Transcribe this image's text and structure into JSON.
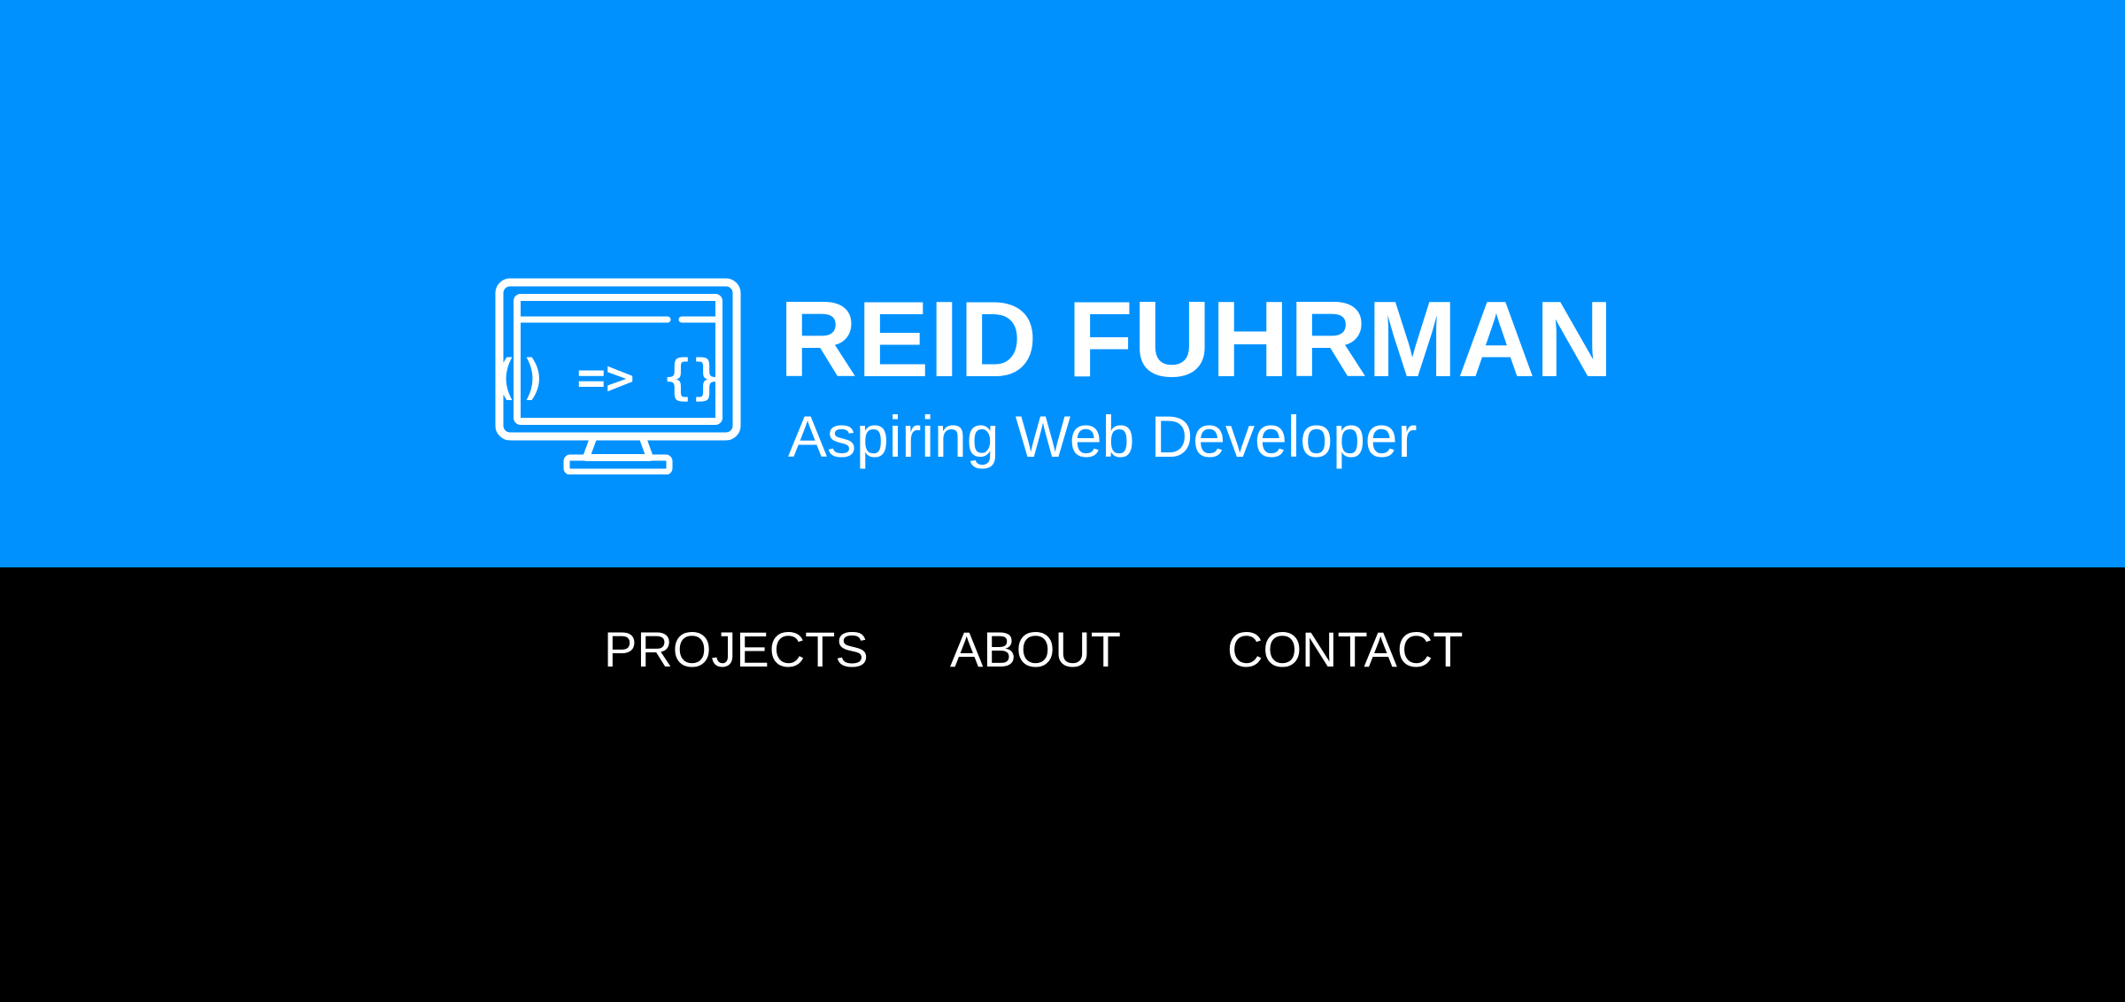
{
  "header": {
    "logo_icon": "monitor-code-icon",
    "logo_glyphs": "() => {}",
    "name": "REID FUHRMAN",
    "tagline": "Aspiring Web Developer",
    "background_color": "#0091ff",
    "text_color": "#ffffff"
  },
  "nav": {
    "background_color": "#000000",
    "items": [
      {
        "label": "PROJECTS"
      },
      {
        "label": "ABOUT"
      },
      {
        "label": "CONTACT"
      }
    ]
  }
}
